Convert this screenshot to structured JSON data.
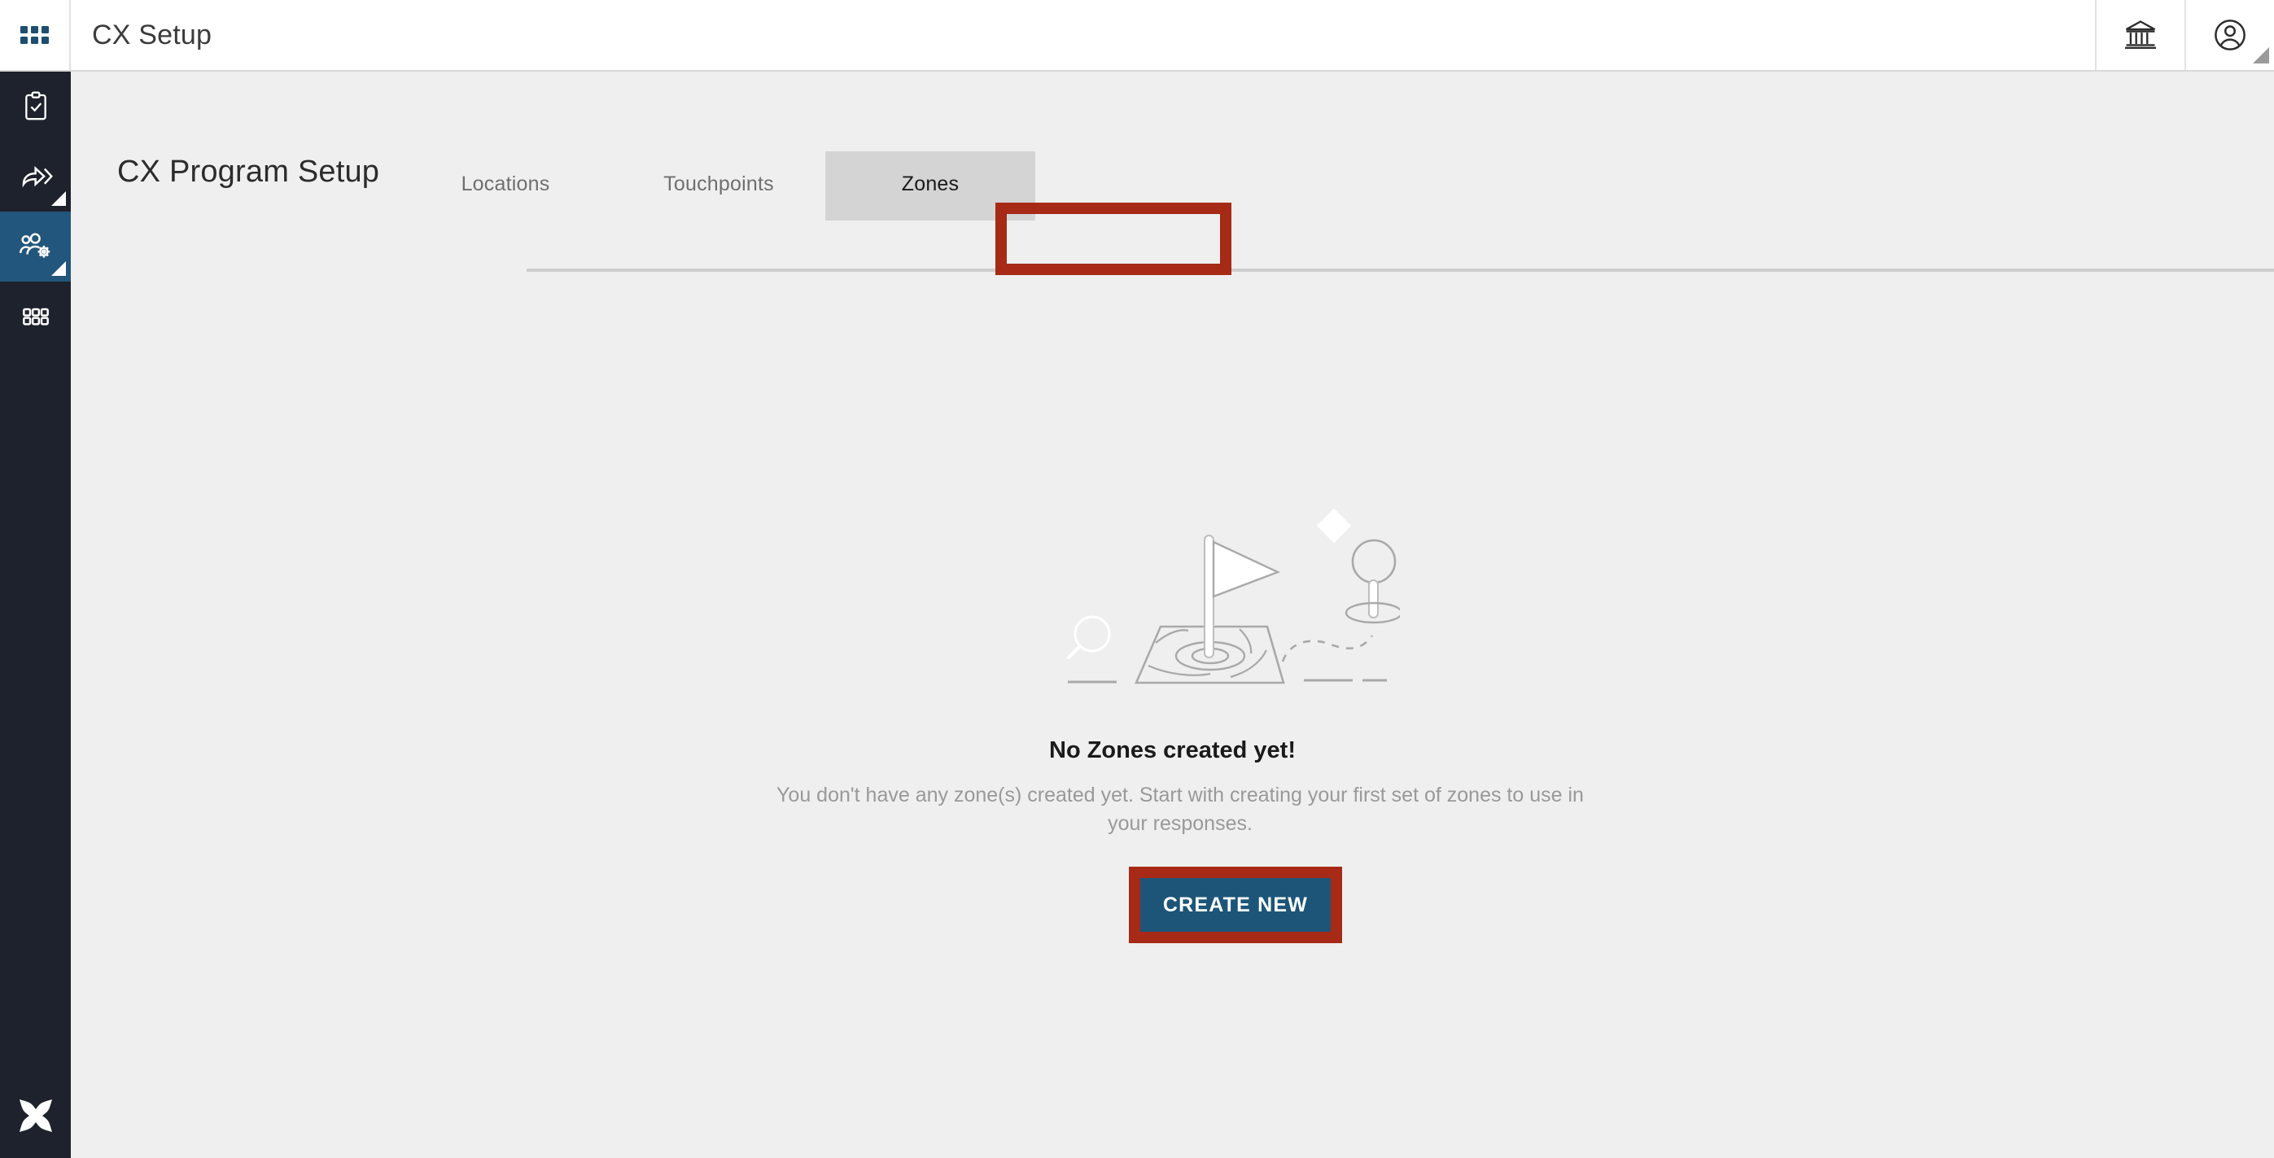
{
  "window": {
    "app_title": "CX Setup"
  },
  "topbar": {
    "waffle_icon": "grid-apps-icon",
    "institution_icon": "bank-institution-icon",
    "account_icon": "user-account-icon"
  },
  "sidebar": {
    "items": [
      {
        "icon": "clipboard-check-icon",
        "active": false,
        "has_corner": false
      },
      {
        "icon": "share-forward-icon",
        "active": false,
        "has_corner": true
      },
      {
        "icon": "people-gear-icon",
        "active": true,
        "has_corner": true
      },
      {
        "icon": "grid-squares-icon",
        "active": false,
        "has_corner": false
      }
    ],
    "logo_icon": "four-petal-star-logo"
  },
  "page": {
    "title": "CX Program Setup",
    "tabs": [
      {
        "label": "Locations",
        "active": false
      },
      {
        "label": "Touchpoints",
        "active": false
      },
      {
        "label": "Zones",
        "active": true
      }
    ]
  },
  "empty_state": {
    "illustration": "map-flag-pin-illustration",
    "title": "No Zones created yet!",
    "subtitle": "You don't have any zone(s) created yet. Start with creating your first set of zones to use in your responses.",
    "primary_button": "CREATE NEW"
  },
  "annotations": {
    "color": "#a62a16",
    "targets": [
      "Zones",
      "CREATE NEW"
    ]
  },
  "colors": {
    "sidebar_bg": "#1e222c",
    "sidebar_active": "#23567c",
    "content_bg": "#efefef",
    "button_blue": "#1d5579",
    "accent_red": "#a62a16",
    "tab_active_bg": "#d4d4d4"
  }
}
